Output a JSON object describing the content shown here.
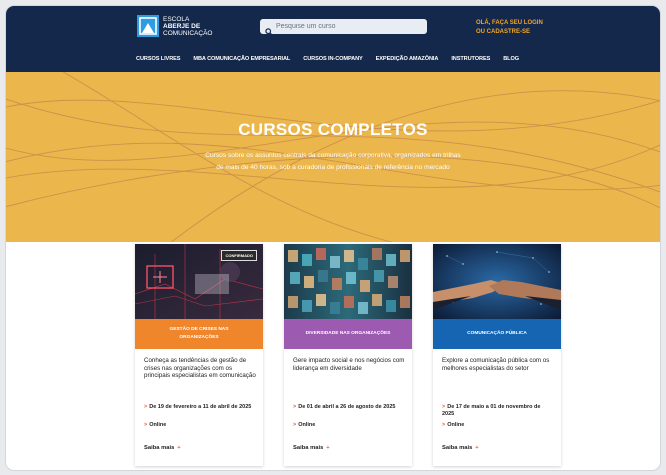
{
  "header": {
    "logo_line1": "ESCOLA",
    "logo_line2": "ABERJE DE",
    "logo_line3": "COMUNICAÇÃO",
    "search_placeholder": "Pesquise um curso",
    "login": "OLÁ, FAÇA SEU LOGIN OU CADASTRE-SE"
  },
  "nav": [
    "CURSOS LIVRES",
    "MBA COMUNICAÇÃO EMPRESARIAL",
    "CURSOS IN-COMPANY",
    "EXPEDIÇÃO AMAZÔNIA",
    "INSTRUTORES",
    "BLOG"
  ],
  "hero": {
    "title": "CURSOS COMPLETOS",
    "subtitle": "Cursos sobre os assuntos centrais da comunicação corporativa, organizados em trilhas de mais de 40 horas, sob a curadoria de profissionais de referência no mercado"
  },
  "colors": {
    "header": "#13284b",
    "hero": "#ebb64b",
    "orange": "#f0862c",
    "purple": "#9c5ab0",
    "blue": "#1565b3",
    "accent": "#f05a28"
  },
  "cards": [
    {
      "badge": "CONFIRMADO",
      "band": "GESTÃO DE CRISES NAS ORGANIZAÇÕES",
      "desc": "Conheça as tendências de gestão de crises nas organizações com os principais especialistas em comunicação",
      "date": "De 19 de fevereiro a 11 de abril de 2025",
      "mode": "Online",
      "more": "Saiba mais",
      "plus": "+"
    },
    {
      "badge": "",
      "band": "DIVERSIDADE NAS ORGANIZAÇÕES",
      "desc": "Gere impacto social e nos negócios com liderança em diversidade",
      "date": "De 01 de abril a 26 de agosto de 2025",
      "mode": "Online",
      "more": "Saiba mais",
      "plus": "+"
    },
    {
      "badge": "",
      "band": "COMUNICAÇÃO PÚBLICA",
      "desc": "Explore a comunicação pública com os melhores especialistas do setor",
      "date": "De 17 de maio a 01 de novembro de 2025",
      "mode": "Online",
      "more": "Saiba mais",
      "plus": "+"
    }
  ],
  "arrow_glyph": ">"
}
